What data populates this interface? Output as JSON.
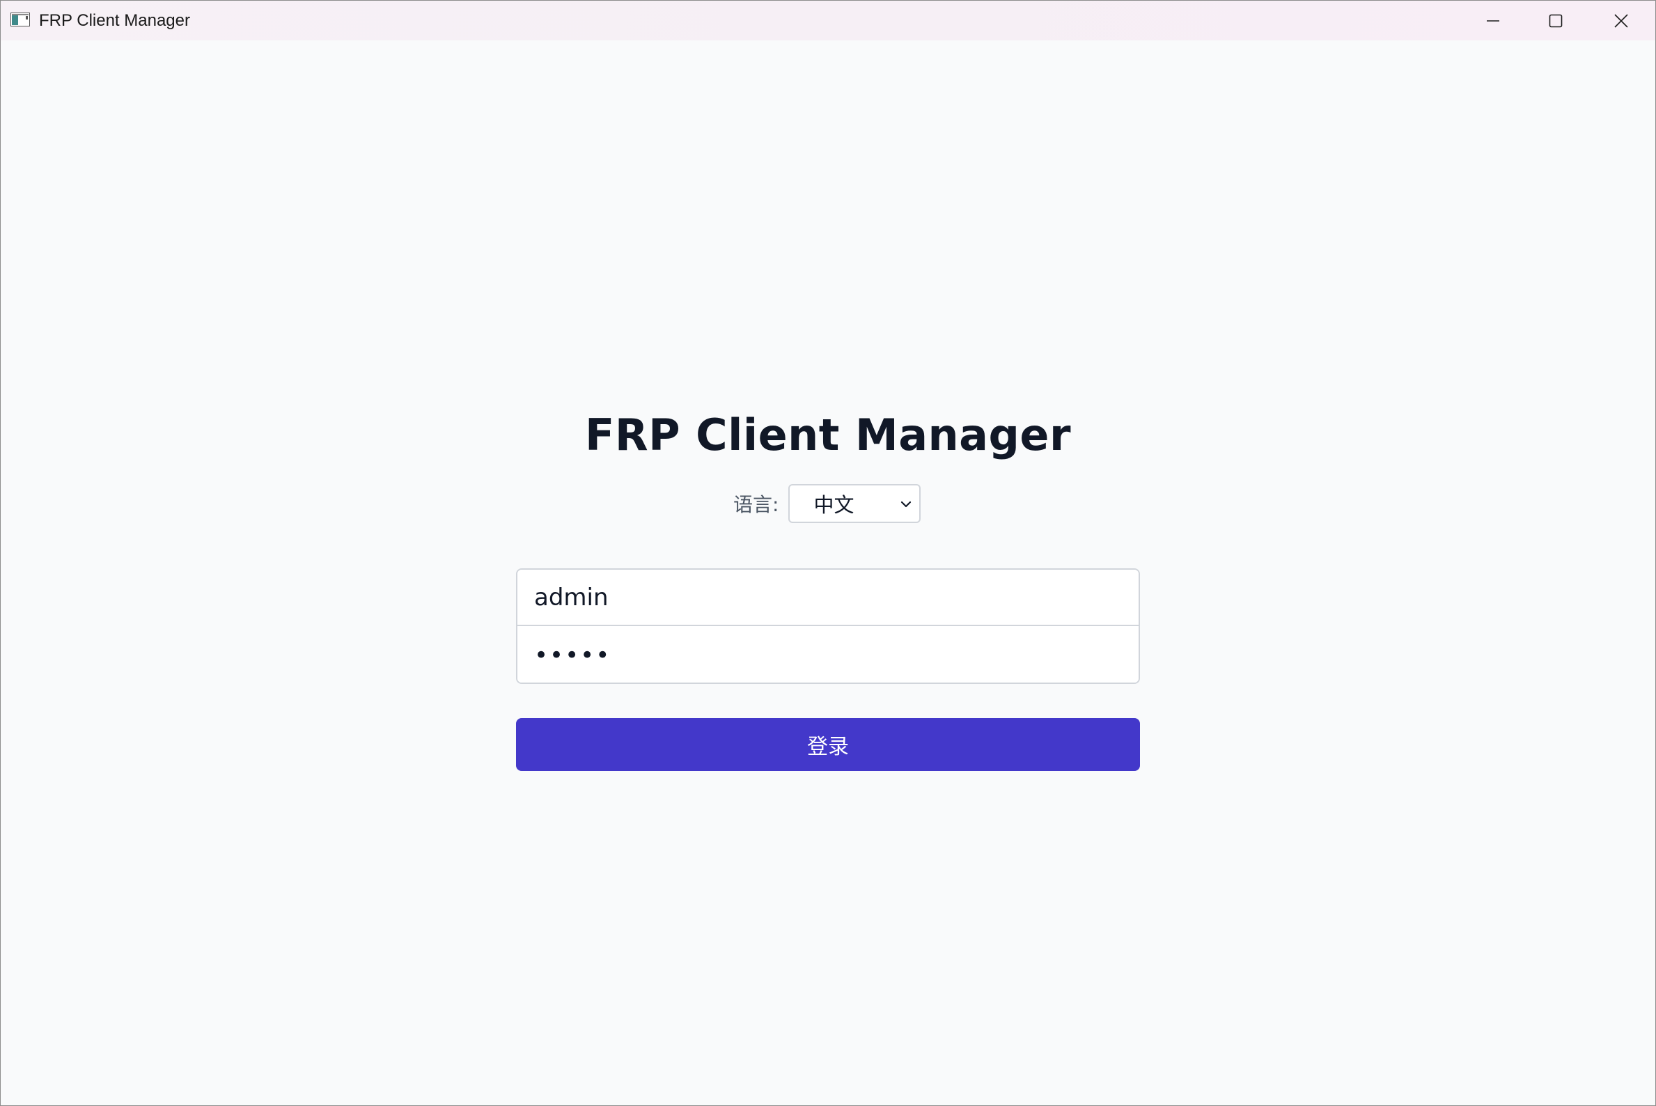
{
  "window": {
    "title": "FRP Client Manager",
    "icon": "app-window-icon",
    "controls": {
      "minimize_icon": "minimize-icon",
      "maximize_icon": "maximize-icon",
      "close_icon": "close-icon"
    }
  },
  "login": {
    "heading": "FRP Client Manager",
    "language_label": "语言:",
    "language_selected": "中文",
    "username_value": "admin",
    "password_value": "•••••",
    "submit_label": "登录"
  },
  "colors": {
    "background": "#f9fafb",
    "accent": "#4338ca",
    "heading_text": "#111827",
    "border": "#d1d5db"
  }
}
